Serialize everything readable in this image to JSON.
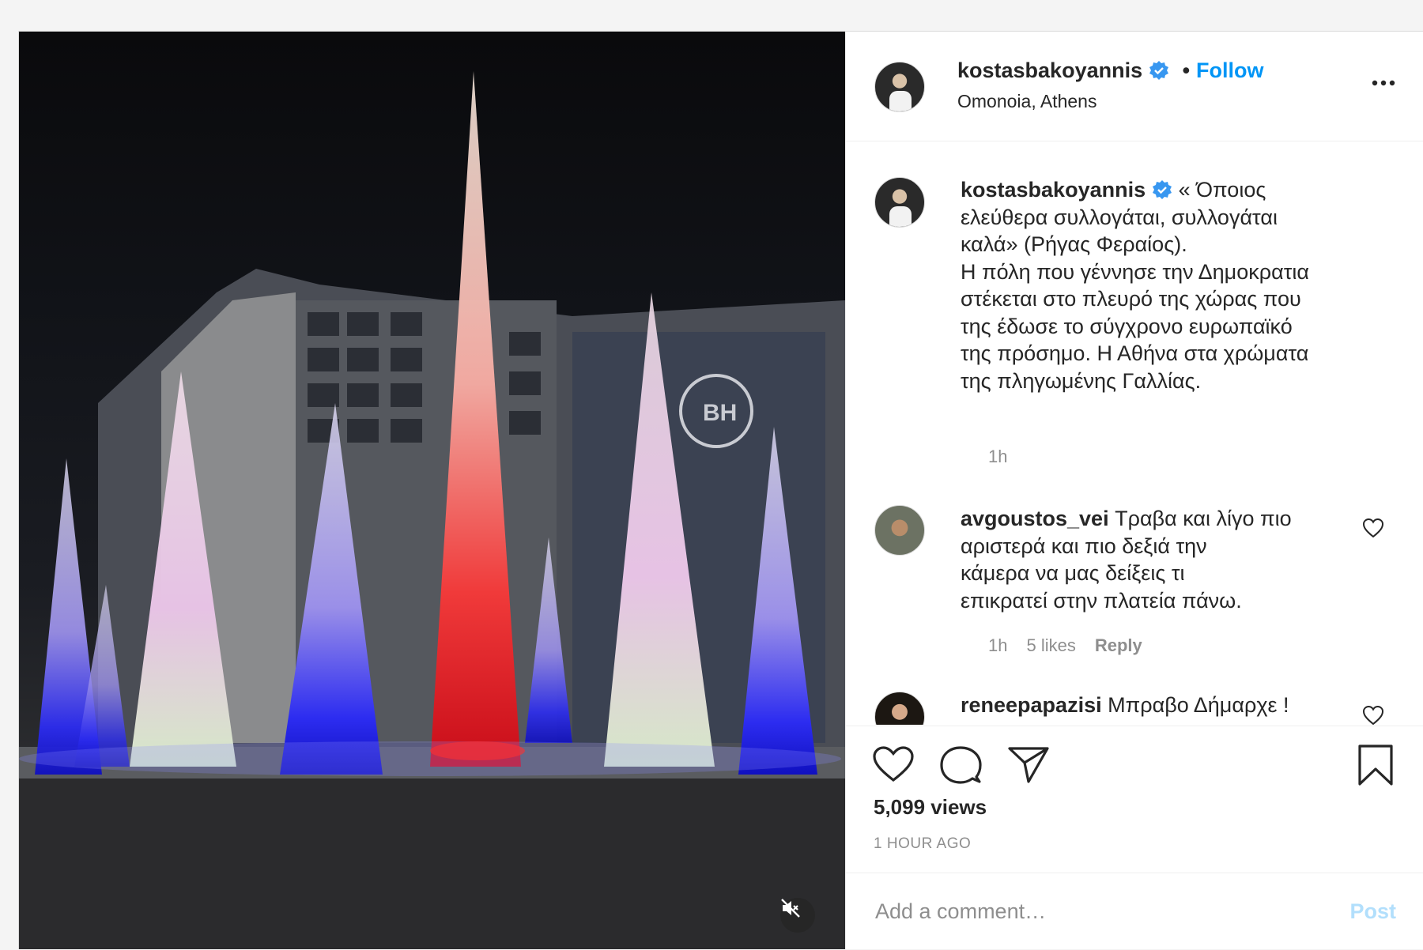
{
  "post": {
    "author": "kostasbakoyannis",
    "follow_label": "Follow",
    "separator": "•",
    "location": "Omonoia, Athens",
    "caption": "« Όποιος\nελεύθερα συλλογάται, συλλογάται\nκαλά» (Ρήγας Φεραίος).\nΗ πόλη που γέννησε την Δημοκρατια\nστέκεται στο πλευρό της χώρας που\nτης έδωσε το σύγχρονο ευρωπαϊκό\nτης πρόσημο. Η Αθήνα στα χρώματα\nτης πληγωμένης Γαλλίας.",
    "caption_time": "1h"
  },
  "comments": [
    {
      "user": "avgoustos_vei",
      "text": "Τραβα και λίγο πιο\nαριστερά και πιο δεξιά την\nκάμερα να μας δείξεις τι\nεπικρατεί στην πλατεία πάνω.",
      "time": "1h",
      "likes": "5 likes",
      "reply": "Reply"
    },
    {
      "user": "reneepapazisi",
      "text": "Μπραβο Δήμαρχε !"
    }
  ],
  "stats": {
    "views": "5,099 views",
    "time_ago": "1 HOUR AGO"
  },
  "composer": {
    "placeholder": "Add a comment…",
    "post_label": "Post"
  },
  "icons": {
    "verified": "verified-badge-icon",
    "more": "more-options-icon",
    "like": "heart-icon",
    "comment": "comment-bubble-icon",
    "share": "paper-plane-icon",
    "save": "bookmark-icon",
    "mute": "muted-speaker-icon"
  },
  "colors": {
    "accent": "#0095f6",
    "muted": "#8e8e8e",
    "post_disabled": "#b2dffc"
  }
}
